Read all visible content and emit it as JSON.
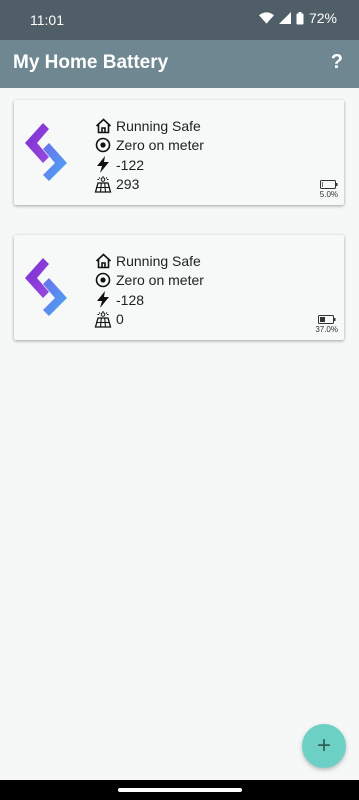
{
  "status": {
    "time": "11:01",
    "battery": "72%"
  },
  "appbar": {
    "title": "My Home Battery",
    "help_label": "?"
  },
  "cards": [
    {
      "status": "Running Safe",
      "mode": "Zero on meter",
      "grid": "-122",
      "solar": "293",
      "battery_pct": "5.0%"
    },
    {
      "status": "Running Safe",
      "mode": "Zero on meter",
      "grid": "-128",
      "solar": "0",
      "battery_pct": "37.0%"
    }
  ],
  "fab": {
    "label": "+"
  },
  "icons": [
    "wifi-icon",
    "cellular-icon",
    "battery-icon",
    "help-icon",
    "app-logo-icon",
    "home-icon",
    "target-icon",
    "bolt-icon",
    "solar-panel-icon",
    "battery-level-icon",
    "plus-icon"
  ],
  "colors": {
    "status_bar": "#4f5e67",
    "app_bar": "#6f8791",
    "fab": "#6dd0c4",
    "logo_purple": "#7a2fd0",
    "logo_blue": "#4aa8f0"
  }
}
